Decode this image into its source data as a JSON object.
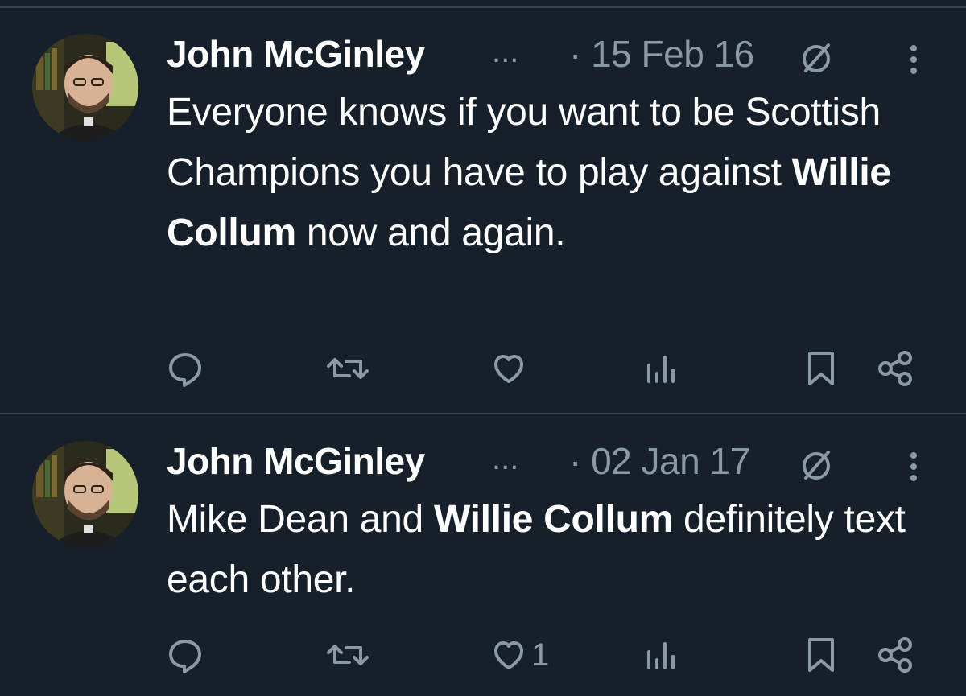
{
  "tweets": [
    {
      "author_name": "John McGinley",
      "ellipsis": "...",
      "date": "· 15 Feb 16",
      "text": {
        "part1": "Everyone knows if you want to be Scottish Champions you have to play against ",
        "bold1": "Willie Collum",
        "part2": " now and again."
      },
      "actions": {
        "reply_count": "",
        "retweet_count": "",
        "like_count": "",
        "views_count": ""
      }
    },
    {
      "author_name": "John McGinley",
      "ellipsis": "...",
      "date": "· 02 Jan 17",
      "text": {
        "part1": "Mike Dean and ",
        "bold1": "Willie Collum",
        "part2": " definitely text each other."
      },
      "actions": {
        "reply_count": "",
        "retweet_count": "",
        "like_count": "1",
        "views_count": ""
      }
    }
  ],
  "icons": {
    "reply": "reply-icon",
    "retweet": "retweet-icon",
    "like": "heart-icon",
    "views": "views-icon",
    "bookmark": "bookmark-icon",
    "share": "share-icon",
    "grok": "grok-icon",
    "more": "more-icon"
  },
  "colors": {
    "background": "#15202b",
    "text": "#ffffff",
    "secondary": "#8b98a5",
    "divider": "#38444d"
  }
}
